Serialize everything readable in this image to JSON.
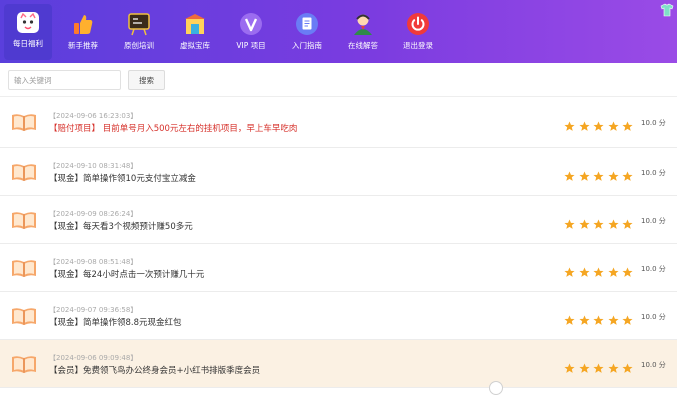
{
  "nav": {
    "items": [
      {
        "label": "每日福利",
        "icon": "cat-mascot-icon",
        "active": true
      },
      {
        "label": "新手推荐",
        "icon": "thumbs-up-icon"
      },
      {
        "label": "原创培训",
        "icon": "training-board-icon"
      },
      {
        "label": "虚拟宝库",
        "icon": "treasure-store-icon"
      },
      {
        "label": "VIP 项目",
        "icon": "vip-badge-icon"
      },
      {
        "label": "入门指南",
        "icon": "guide-document-icon"
      },
      {
        "label": "在线解答",
        "icon": "support-agent-icon"
      },
      {
        "label": "退出登录",
        "icon": "power-icon"
      }
    ]
  },
  "search": {
    "placeholder": "输入关键词",
    "button_label": "搜索"
  },
  "posts": [
    {
      "date": "【2024-09-06 16:23:03】",
      "title": "【赔付项目】 目前单号月入500元左右的挂机项目，早上车早吃肉",
      "rating": 5,
      "score": "10.0 分"
    },
    {
      "date": "【2024-09-10 08:31:48】",
      "title": "【现金】简单操作领10元支付宝立减金",
      "rating": 5,
      "score": "10.0 分"
    },
    {
      "date": "【2024-09-09 08:26:24】",
      "title": "【现金】每天看3个视频预计赚50多元",
      "rating": 5,
      "score": "10.0 分"
    },
    {
      "date": "【2024-09-08 08:51:48】",
      "title": "【现金】每24小时点击一次预计赚几十元",
      "rating": 5,
      "score": "10.0 分"
    },
    {
      "date": "【2024-09-07 09:36:58】",
      "title": "【现金】简单操作领8.8元现金红包",
      "rating": 5,
      "score": "10.0 分"
    },
    {
      "date": "【2024-09-06 09:09:48】",
      "title": "【会员】免费领飞鸟办公终身会员+小红书排版季度会员",
      "rating": 5,
      "score": "10.0 分"
    }
  ],
  "colors": {
    "nav_gradient_start": "#5a3fdc",
    "nav_gradient_end": "#9a4be6",
    "pinned_title": "#d6302a",
    "star": "#f5a623",
    "highlight_row": "#fbf1e3"
  }
}
